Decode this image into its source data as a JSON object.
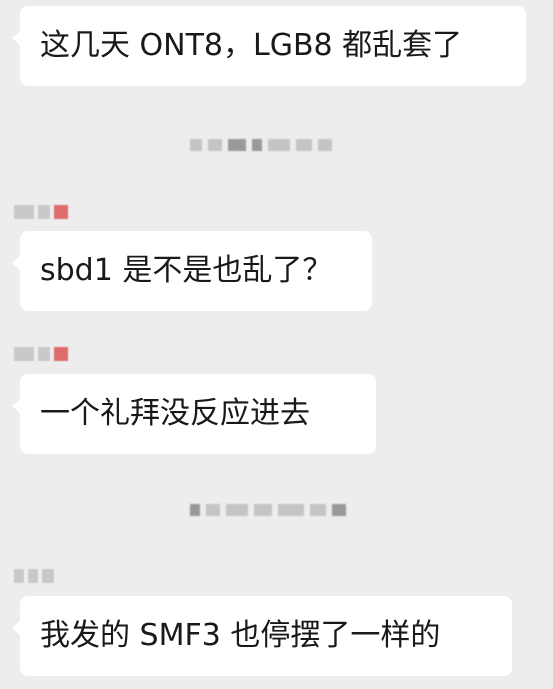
{
  "messages": [
    {
      "text": "这几天 ONT8，LGB8 都乱套了"
    },
    {
      "text": "sbd1 是不是也乱了？"
    },
    {
      "text": "一个礼拜没反应进去"
    },
    {
      "text": "我发的 SMF3 也停摆了一样的"
    }
  ],
  "colors": {
    "background": "#ededed",
    "bubble": "#ffffff",
    "text": "#191919"
  }
}
